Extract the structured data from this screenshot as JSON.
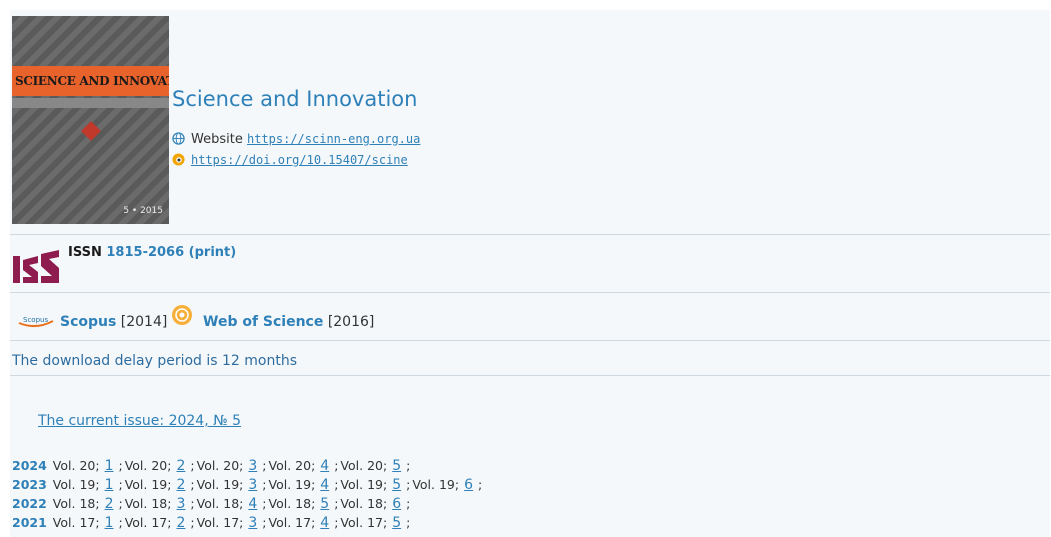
{
  "journal": {
    "title": "Science and Innovation",
    "cover": {
      "band_text": "SCIENCE AND INNOVATION",
      "issue_text": "5 • 2015"
    },
    "website_label": "Website",
    "website_url": "https://scinn-eng.org.ua",
    "doi_url": "https://doi.org/10.15407/scine"
  },
  "issn": {
    "label": "ISSN",
    "value": "1815-2066 (print)"
  },
  "indexing": {
    "scopus_logo_text": "Scopus",
    "scopus_name": "Scopus",
    "scopus_year": "[2014]",
    "wos_name": "Web of Science",
    "wos_year": "[2016]"
  },
  "delay_text": "The download delay period is 12 months",
  "current_issue": "The current issue: 2024, № 5",
  "archive": [
    {
      "year": "2024",
      "vol": "Vol. 20;",
      "issues": [
        "1",
        "2",
        "3",
        "4",
        "5"
      ]
    },
    {
      "year": "2023",
      "vol": "Vol. 19;",
      "issues": [
        "1",
        "2",
        "3",
        "4",
        "5",
        "6"
      ]
    },
    {
      "year": "2022",
      "vol": "Vol. 18;",
      "issues": [
        "2",
        "3",
        "4",
        "5",
        "6"
      ]
    },
    {
      "year": "2021",
      "vol": "Vol. 17;",
      "issues": [
        "1",
        "2",
        "3",
        "4",
        "5"
      ]
    }
  ],
  "colors": {
    "link": "#2e80b8",
    "issn_brand": "#8e1c4e",
    "cover_band": "#e8632b"
  },
  "icons": {
    "website": "globe-icon",
    "doi": "doi-icon",
    "issn": "issn-logo",
    "scopus": "scopus-logo",
    "wos": "web-of-science-logo"
  }
}
